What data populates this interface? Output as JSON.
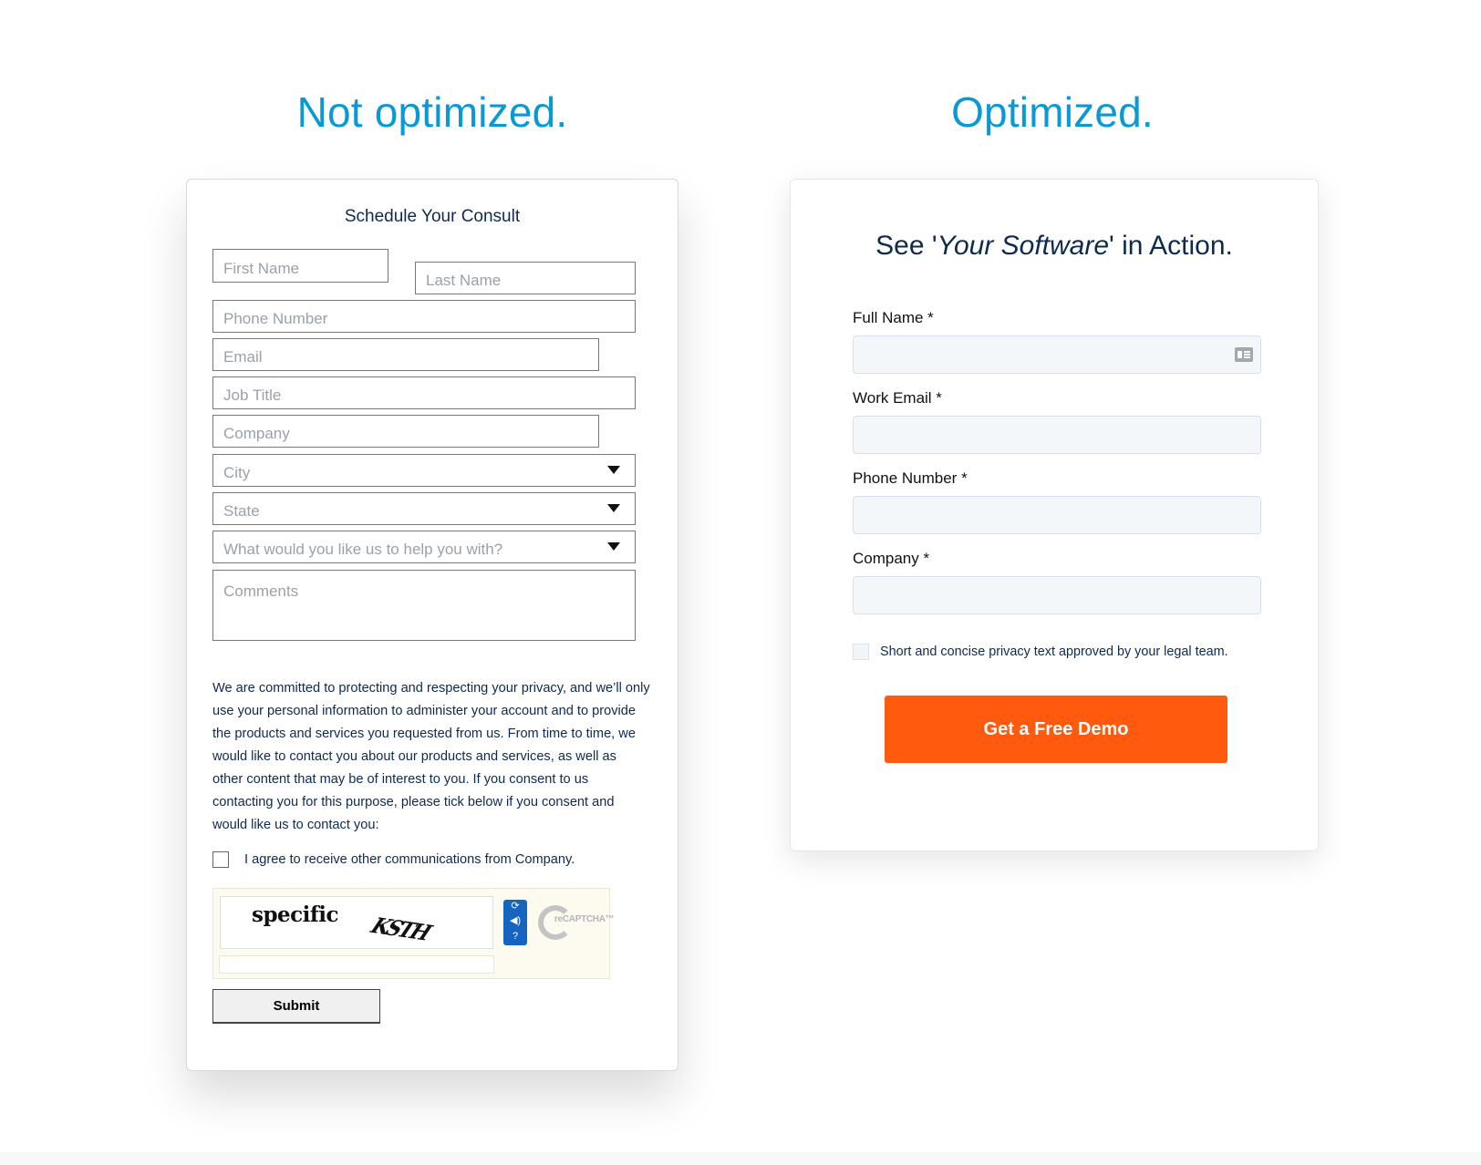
{
  "comparison": {
    "left_title": "Not optimized.",
    "right_title": "Optimized."
  },
  "colors": {
    "title_blue": "#0a99d4",
    "text_navy": "#0e2a4f",
    "cta_orange": "#ff5a0e",
    "captcha_blue": "#1565c0"
  },
  "left_form": {
    "heading": "Schedule Your Consult",
    "fields": {
      "first_name": {
        "placeholder": "First  Name"
      },
      "last_name": {
        "placeholder": "Last Name"
      },
      "phone": {
        "placeholder": "Phone Number"
      },
      "email": {
        "placeholder": "Email"
      },
      "job_title": {
        "placeholder": "Job Title"
      },
      "company": {
        "placeholder": "Company"
      },
      "city": {
        "placeholder": "City",
        "icon": "caret-down-icon"
      },
      "state": {
        "placeholder": "State",
        "icon": "caret-down-icon"
      },
      "help_with": {
        "placeholder": "What would you like us to help you with?",
        "icon": "caret-down-icon"
      },
      "comments": {
        "placeholder": "Comments"
      }
    },
    "privacy_text": "We are committed to protecting and respecting your privacy, and we’ll only use your personal information to administer your account and to provide the products and services you requested from us. From time to time, we would like to contact you about our products and services, as well as other content that may be of interest to you. If you consent to us contacting you for this purpose, please tick below if you consent and would like us to contact you:",
    "consent_label": "I agree to receive other communications from Company.",
    "consent_checked": false,
    "captcha": {
      "word1": "specific",
      "word2": "KSTH",
      "buttons": [
        {
          "icon": "refresh-icon",
          "glyph": "⟳"
        },
        {
          "icon": "audio-icon",
          "glyph": "◀)"
        },
        {
          "icon": "help-icon",
          "glyph": "?"
        }
      ],
      "logo_text": "reCAPTCHA™",
      "answer_value": ""
    },
    "submit_label": "Submit"
  },
  "right_form": {
    "heading_prefix": "See '",
    "heading_emphasis": "Your Software",
    "heading_suffix": "' in Action.",
    "fields": [
      {
        "label": "Full Name *",
        "value": "",
        "icon": "contact-card-icon"
      },
      {
        "label": "Work Email *",
        "value": ""
      },
      {
        "label": "Phone Number *",
        "value": ""
      },
      {
        "label": "Company *",
        "value": ""
      }
    ],
    "consent_label": "Short and concise privacy text approved by your legal team.",
    "consent_checked": false,
    "cta_label": "Get a Free Demo"
  }
}
